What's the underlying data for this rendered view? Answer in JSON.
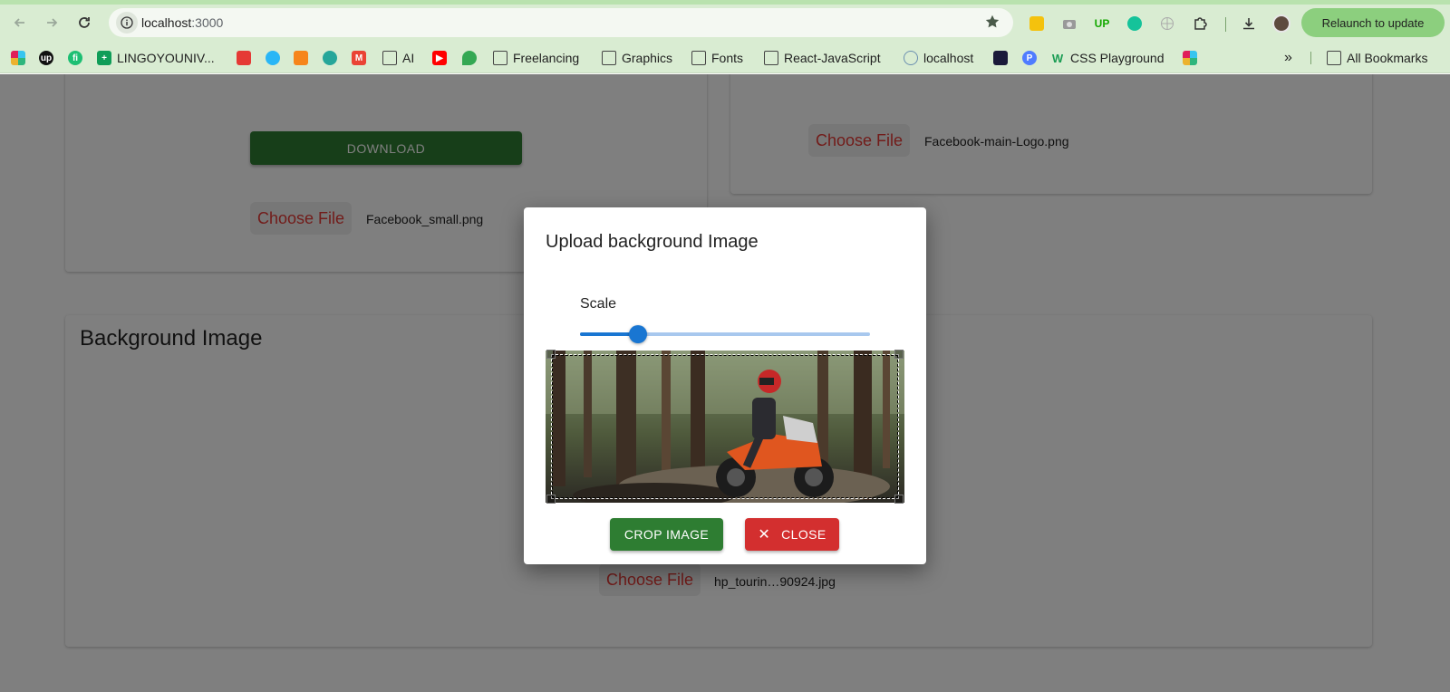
{
  "browser": {
    "url_host": "localhost",
    "url_port": ":3000",
    "relaunch_label": "Relaunch to update",
    "bookmarks": [
      {
        "name": "slack",
        "label": ""
      },
      {
        "name": "upwork",
        "label": ""
      },
      {
        "name": "fiverr",
        "label": ""
      },
      {
        "name": "lingoyouniv",
        "label": "LINGOYOUNIV..."
      },
      {
        "name": "bookmark-5",
        "label": ""
      },
      {
        "name": "bookmark-6",
        "label": ""
      },
      {
        "name": "metamask",
        "label": ""
      },
      {
        "name": "bookmark-8",
        "label": ""
      },
      {
        "name": "gmail",
        "label": ""
      },
      {
        "name": "ai",
        "label": "AI"
      },
      {
        "name": "youtube",
        "label": ""
      },
      {
        "name": "maps",
        "label": ""
      },
      {
        "name": "freelancing",
        "label": "Freelancing"
      },
      {
        "name": "graphics",
        "label": "Graphics"
      },
      {
        "name": "fonts",
        "label": "Fonts"
      },
      {
        "name": "react-javascript",
        "label": "React-JavaScript"
      },
      {
        "name": "localhost",
        "label": "localhost"
      },
      {
        "name": "bookmark-18",
        "label": ""
      },
      {
        "name": "bookmark-19",
        "label": ""
      },
      {
        "name": "css-playground",
        "label": "CSS Playground"
      },
      {
        "name": "slack-2",
        "label": ""
      }
    ],
    "all_bookmarks": "All Bookmarks"
  },
  "page": {
    "download_label": "DOWNLOAD",
    "left_card": {
      "choose_label": "Choose File",
      "file_name": "Facebook_small.png"
    },
    "right_card": {
      "choose_label": "Choose File",
      "file_name": "Facebook-main-Logo.png"
    },
    "background_section": {
      "title": "Background Image",
      "choose_label": "Choose File",
      "file_name": "hp_tourin…90924.jpg"
    }
  },
  "dialog": {
    "title": "Upload background Image",
    "scale_label": "Scale",
    "scale_value": 0.2,
    "crop_label": "CROP IMAGE",
    "close_label": "CLOSE"
  },
  "colors": {
    "primary": "#1976d2",
    "success": "#2e7d32",
    "danger": "#d32f2f",
    "chrome": "#d9ecd2"
  }
}
